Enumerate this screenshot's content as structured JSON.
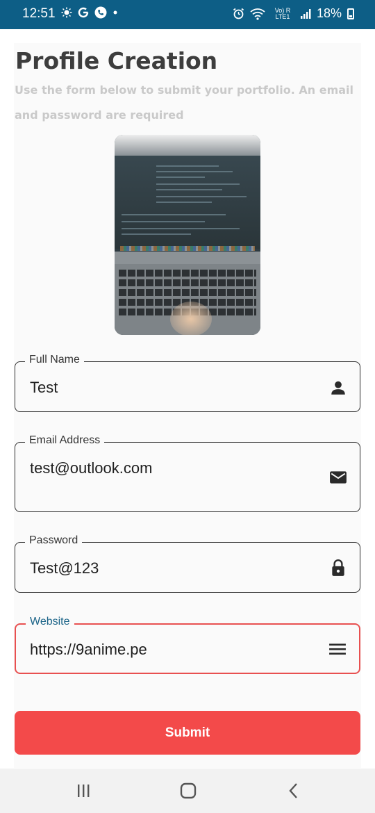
{
  "status_bar": {
    "time": "12:51",
    "left_icons": [
      "sun-icon",
      "google-g-icon",
      "phone-call-icon",
      "dot-icon"
    ],
    "network": "Vo) R LTE1",
    "battery": "18%"
  },
  "header": {
    "title": "Profile Creation",
    "subtitle": "Use the form below to submit your portfolio. An email and password are required"
  },
  "photo": {
    "description": "laptop-with-code-photo"
  },
  "form": {
    "full_name": {
      "label": "Full Name",
      "value": "Test",
      "icon": "person-icon"
    },
    "email": {
      "label": "Email Address",
      "value": "test@outlook.com",
      "icon": "mail-icon"
    },
    "password": {
      "label": "Password",
      "value": "Test@123",
      "icon": "lock-icon"
    },
    "website": {
      "label": "Website",
      "value": "https://9anime.pe",
      "icon": "menu-icon",
      "focused": true
    }
  },
  "submit_label": "Submit",
  "colors": {
    "status_bar": "#0d5e86",
    "accent": "#f34a4a",
    "focused_label": "#1a6387",
    "subtitle": "#c9c9c9"
  },
  "nav_bar": {
    "icons": [
      "recent-apps-icon",
      "home-icon",
      "back-icon"
    ]
  }
}
